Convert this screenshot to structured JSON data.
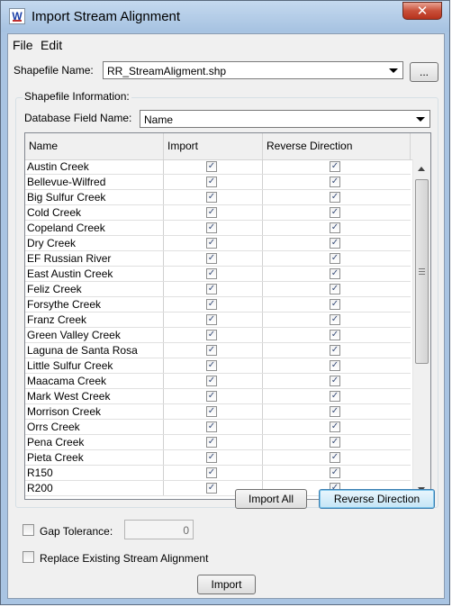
{
  "window": {
    "title": "Import Stream Alignment",
    "close_glyph": "✕"
  },
  "menu": {
    "file": "File",
    "edit": "Edit"
  },
  "shapefile": {
    "label": "Shapefile Name:",
    "value": "RR_StreamAligment.shp",
    "browse_label": "..."
  },
  "info": {
    "group_label": "Shapefile Information:",
    "field_label": "Database Field Name:",
    "field_value": "Name"
  },
  "table": {
    "columns": [
      "Name",
      "Import",
      "Reverse Direction"
    ],
    "rows": [
      {
        "name": "Austin Creek",
        "import": true,
        "reverse": true
      },
      {
        "name": "Bellevue-Wilfred",
        "import": true,
        "reverse": true
      },
      {
        "name": "Big Sulfur Creek",
        "import": true,
        "reverse": true
      },
      {
        "name": "Cold Creek",
        "import": true,
        "reverse": true
      },
      {
        "name": "Copeland Creek",
        "import": true,
        "reverse": true
      },
      {
        "name": "Dry Creek",
        "import": true,
        "reverse": true
      },
      {
        "name": "EF Russian River",
        "import": true,
        "reverse": true
      },
      {
        "name": "East Austin Creek",
        "import": true,
        "reverse": true
      },
      {
        "name": "Feliz Creek",
        "import": true,
        "reverse": true
      },
      {
        "name": "Forsythe Creek",
        "import": true,
        "reverse": true
      },
      {
        "name": "Franz Creek",
        "import": true,
        "reverse": true
      },
      {
        "name": "Green Valley Creek",
        "import": true,
        "reverse": true
      },
      {
        "name": "Laguna de Santa Rosa",
        "import": true,
        "reverse": true
      },
      {
        "name": "Little Sulfur Creek",
        "import": true,
        "reverse": true
      },
      {
        "name": "Maacama Creek",
        "import": true,
        "reverse": true
      },
      {
        "name": "Mark West Creek",
        "import": true,
        "reverse": true
      },
      {
        "name": "Morrison Creek",
        "import": true,
        "reverse": true
      },
      {
        "name": "Orrs Creek",
        "import": true,
        "reverse": true
      },
      {
        "name": "Pena Creek",
        "import": true,
        "reverse": true
      },
      {
        "name": "Pieta Creek",
        "import": true,
        "reverse": true
      },
      {
        "name": "R150",
        "import": true,
        "reverse": true
      },
      {
        "name": "R200",
        "import": true,
        "reverse": true
      }
    ],
    "check_glyph": "✓"
  },
  "buttons": {
    "import_all": "Import All",
    "reverse_direction": "Reverse Direction",
    "import": "Import"
  },
  "gap_tolerance": {
    "label": "Gap Tolerance:",
    "value": "0",
    "checked": false
  },
  "replace_existing": {
    "label": "Replace Existing Stream Alignment",
    "checked": false
  }
}
